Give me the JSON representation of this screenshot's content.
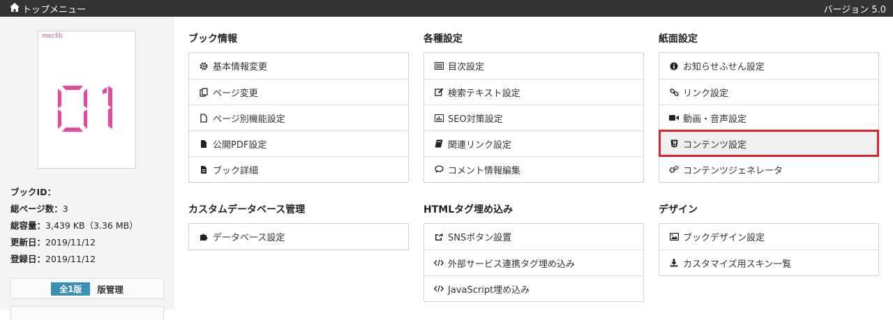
{
  "topbar": {
    "home_label": "トップメニュー",
    "version": "バージョン 5.0"
  },
  "book": {
    "thumb_brand": "meclib",
    "thumb_number": "01",
    "id_label": "ブックID：",
    "id_value": "",
    "pages_label": "総ページ数：",
    "pages_value": "3",
    "size_label": "総容量：",
    "size_value": "3,439 KB（3.36 MB）",
    "updated_label": "更新日：",
    "updated_value": "2019/11/12",
    "registered_label": "登録日：",
    "registered_value": "2019/11/12",
    "version_badge": "全1版",
    "version_manage": "版管理"
  },
  "sections": {
    "book_info": {
      "title": "ブック情報",
      "items": [
        "基本情報変更",
        "ページ変更",
        "ページ別機能設定",
        "公開PDF設定",
        "ブック詳細"
      ]
    },
    "settings": {
      "title": "各種設定",
      "items": [
        "目次設定",
        "検索テキスト設定",
        "SEO対策設定",
        "関連リンク設定",
        "コメント情報編集"
      ]
    },
    "page_settings": {
      "title": "紙面設定",
      "items": [
        "お知らせふせん設定",
        "リンク設定",
        "動画・音声設定",
        "コンテンツ設定",
        "コンテンツジェネレータ"
      ]
    },
    "database": {
      "title": "カスタムデータベース管理",
      "items": [
        "データベース設定"
      ]
    },
    "html_embed": {
      "title": "HTMLタグ埋め込み",
      "items": [
        "SNSボタン設置",
        "外部サービス連携タグ埋め込み",
        "JavaScript埋め込み"
      ]
    },
    "design": {
      "title": "デザイン",
      "items": [
        "ブックデザイン設定",
        "カスタマイズ用スキン一覧"
      ]
    }
  },
  "icons": {
    "book_info": [
      "gear-icon",
      "copy-icon",
      "file-icon",
      "file-filled-icon",
      "file-text-icon"
    ],
    "settings": [
      "list-icon",
      "edit-icon",
      "bar-chart-icon",
      "book-icon",
      "comment-icon"
    ],
    "page_settings": [
      "info-icon",
      "link-icon",
      "video-icon",
      "html5-icon",
      "gears-icon"
    ],
    "database": [
      "puzzle-icon"
    ],
    "html_embed": [
      "share-icon",
      "code-icon",
      "code-icon"
    ],
    "design": [
      "image-icon",
      "download-icon"
    ]
  },
  "colors": {
    "topbar": "#333333",
    "accent_pink": "#e44c9a",
    "badge_blue": "#3a8fb7",
    "highlight_red": "#d9232e"
  },
  "selected_item": "コンテンツ設定"
}
